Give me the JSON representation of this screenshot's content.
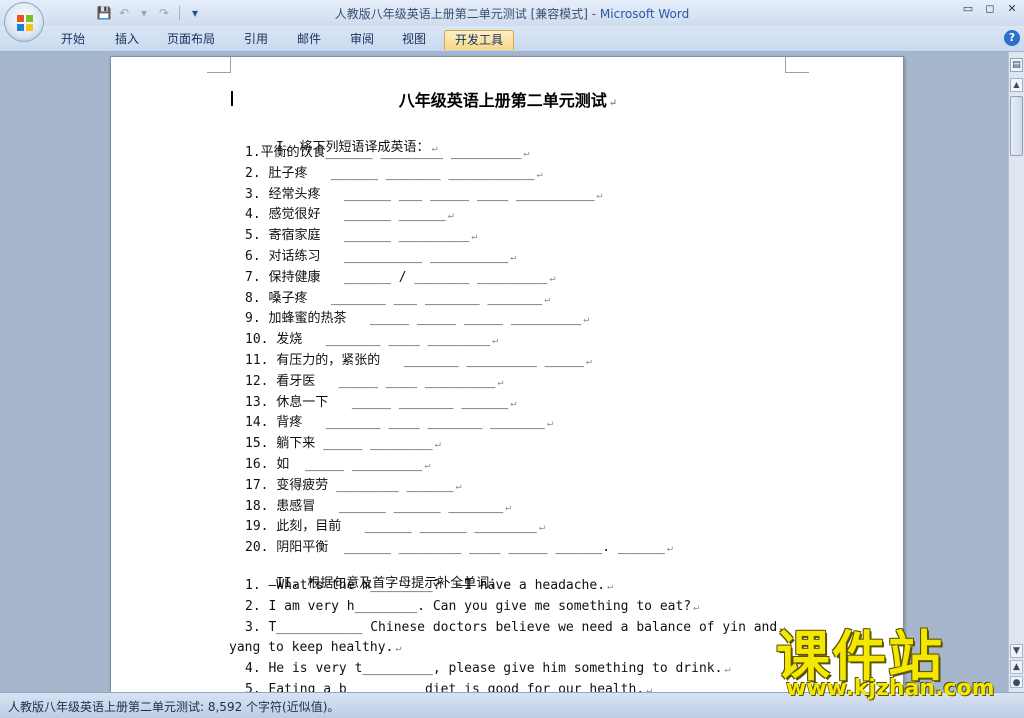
{
  "window": {
    "title_doc": "人教版八年级英语上册第二单元测试 [兼容模式] - ",
    "title_app": "Microsoft Word",
    "controls": [
      "▭",
      "◻",
      "✕"
    ]
  },
  "qat": {
    "save_icon": "💾",
    "undo_icon": "↶",
    "dropdown_icon": "▾",
    "redo_icon": "↷",
    "customize_icon": "▾"
  },
  "tabs": [
    {
      "label": "开始"
    },
    {
      "label": "插入"
    },
    {
      "label": "页面布局"
    },
    {
      "label": "引用"
    },
    {
      "label": "邮件"
    },
    {
      "label": "审阅"
    },
    {
      "label": "视图"
    },
    {
      "label": "开发工具"
    }
  ],
  "help_label": "?",
  "document": {
    "title": "八年级英语上册第二单元测试",
    "section1_heading": "I. 将下列短语译成英语：",
    "section1_items": [
      "1.平衡的饮食______ ________ _________",
      "2. 肚子疼   ______ _______ ___________",
      "3. 经常头疼   ______ ___ _____ ____ __________",
      "4. 感觉很好   ______ ______",
      "5. 寄宿家庭   ______ _________",
      "6. 对话练习   __________ __________",
      "7. 保持健康   ______ / _______ _________",
      "8. 嗓子疼   _______ ___ _______ _______",
      "9. 加蜂蜜的热茶   _____ _____ _____ _________",
      "10. 发烧   _______ ____ ________",
      "11. 有压力的，紧张的   _______ _________ _____",
      "12. 看牙医   _____ ____ _________",
      "13. 休息一下   _____ _______ ______",
      "14. 背疼   _______ ____ _______ _______",
      "15. 躺下来 _____ ________",
      "16. 如  _____ _________",
      "17. 变得疲劳 ________ ______",
      "18. 患感冒   ______ ______ _______",
      "19. 此刻，目前   ______ ______ ________",
      "20. 阴阳平衡  ______ ________ ____ _____ ______. ______"
    ],
    "section2_heading": "II. 根据句意及首字母提示补全单词：",
    "section2_items": [
      "1. —What’s the m________?  —I have a headache.",
      "2. I am very h________. Can you give me something to eat?",
      "3. T___________ Chinese doctors believe we need a balance of yin and",
      "yang to keep healthy.",
      "4. He is very t_________, please give him something to drink.",
      "5. Eating a b_________ diet is good for our health."
    ],
    "para_mark": "↵"
  },
  "status": {
    "text": "人教版八年级英语上册第二单元测试: 8,592 个字符(近似值)。"
  },
  "scrollbar": {
    "ruler_icon": "▤",
    "up_icon": "▲",
    "down_icon": "▼",
    "prev_icon": "▲",
    "select_icon": "●",
    "next_icon": "▼"
  },
  "watermark": {
    "big": "课件站",
    "url": "www.kjzhan.com"
  }
}
